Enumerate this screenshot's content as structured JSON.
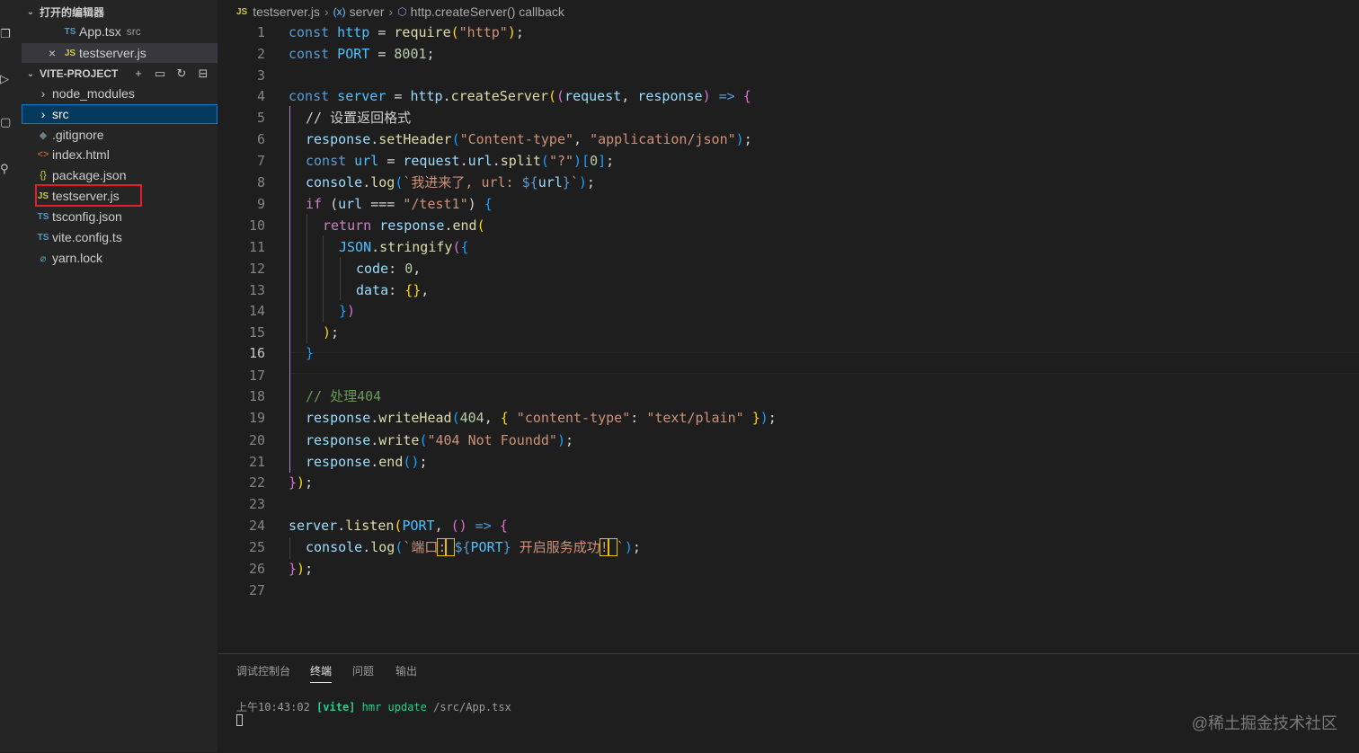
{
  "open_editors": {
    "header": "打开的编辑器",
    "items": [
      {
        "badge": "TS",
        "name": "App.tsx",
        "suffix": "src"
      },
      {
        "badge": "JS",
        "name": "testserver.js",
        "close": "×"
      }
    ]
  },
  "explorer": {
    "header": "VITE-PROJECT",
    "items": [
      {
        "icon": "›",
        "name": "node_modules"
      },
      {
        "icon": "›",
        "name": "src"
      },
      {
        "icon": "◆",
        "name": ".gitignore"
      },
      {
        "icon": "<>",
        "name": "index.html"
      },
      {
        "icon": "{}",
        "name": "package.json"
      },
      {
        "icon": "JS",
        "name": "testserver.js"
      },
      {
        "icon": "TS",
        "name": "tsconfig.json"
      },
      {
        "icon": "TS",
        "name": "vite.config.ts"
      },
      {
        "icon": "⌀",
        "name": "yarn.lock"
      }
    ]
  },
  "breadcrumb": {
    "file_badge": "JS",
    "file": "testserver.js",
    "sep": "›",
    "symbol1": "server",
    "symbol2": "http.createServer() callback"
  },
  "editor": {
    "current_line": 16,
    "lines": [
      "1",
      "2",
      "3",
      "4",
      "5",
      "6",
      "7",
      "8",
      "9",
      "10",
      "11",
      "12",
      "13",
      "14",
      "15",
      "16",
      "17",
      "18",
      "19",
      "20",
      "21",
      "22",
      "23",
      "24",
      "25",
      "26",
      "27"
    ]
  },
  "code": {
    "l1": {
      "a": "const",
      "b": " http ",
      "c": "=",
      "d": " require",
      "e": "(",
      "f": "\"http\"",
      "g": ")",
      "h": ";"
    },
    "l2": {
      "a": "const",
      "b": " PORT ",
      "c": "=",
      "d": " 8001",
      "e": ";"
    },
    "l4": {
      "a": "const",
      "b": " server ",
      "c": "=",
      "d": " http",
      "e": ".",
      "f": "createServer",
      "g": "(",
      "h": "(",
      "i": "request",
      "j": ", ",
      "k": "response",
      "l": ")",
      "m": " => ",
      "n": "{"
    },
    "l5": "// 设置返回格式",
    "l6": {
      "a": "response",
      "b": ".",
      "c": "setHeader",
      "d": "(",
      "e": "\"Content-type\"",
      "f": ", ",
      "g": "\"application/json\"",
      "h": ")",
      "i": ";"
    },
    "l7": {
      "a": "const",
      "b": " url ",
      "c": "=",
      "d": " request",
      "e": ".",
      "f": "url",
      "g": ".",
      "h": "split",
      "i": "(",
      "j": "\"?\"",
      "k": ")",
      "l": "[",
      "m": "0",
      "n": "]",
      "o": ";"
    },
    "l8": {
      "a": "console",
      "b": ".",
      "c": "log",
      "d": "(",
      "e": "`我进来了, url: ",
      "f": "${",
      "g": "url",
      "h": "}",
      "i": "`",
      "j": ")",
      "k": ";"
    },
    "l9": {
      "a": "if",
      "b": " (",
      "c": "url",
      "d": " === ",
      "e": "\"/test1\"",
      "f": ") ",
      "g": "{"
    },
    "l10": {
      "a": "return",
      "b": " response",
      "c": ".",
      "d": "end",
      "e": "("
    },
    "l11": {
      "a": "JSON",
      "b": ".",
      "c": "stringify",
      "d": "(",
      "e": "{"
    },
    "l12": {
      "a": "code",
      "b": ": ",
      "c": "0",
      "d": ","
    },
    "l13": {
      "a": "data",
      "b": ": ",
      "c": "{}",
      "d": ","
    },
    "l14": {
      "a": "}",
      "b": ")"
    },
    "l15": {
      "a": ")",
      "b": ";"
    },
    "l16": "}",
    "l18": "// 处理404",
    "l19": {
      "a": "response",
      "b": ".",
      "c": "writeHead",
      "d": "(",
      "e": "404",
      "f": ", ",
      "g": "{",
      "h": " \"content-type\"",
      "i": ": ",
      "j": "\"text/plain\"",
      "k": " }",
      "l": ")",
      "m": ";"
    },
    "l20": {
      "a": "response",
      "b": ".",
      "c": "write",
      "d": "(",
      "e": "\"404 Not Foundd\"",
      "f": ")",
      "g": ";"
    },
    "l21": {
      "a": "response",
      "b": ".",
      "c": "end",
      "d": "()",
      "e": ";"
    },
    "l22": {
      "a": "}",
      "b": ")",
      "c": ";"
    },
    "l24": {
      "a": "server",
      "b": ".",
      "c": "listen",
      "d": "(",
      "e": "PORT",
      "f": ", ",
      "g": "()",
      "h": " => ",
      "i": "{"
    },
    "l25": {
      "a": "console",
      "b": ".",
      "c": "log",
      "d": "(",
      "e": "`端口",
      "f": ":",
      "g": " ",
      "h": "${",
      "i": "PORT",
      "j": "}",
      "k": " 开启服务成功",
      "l": "!",
      "m": " ",
      "n": "`",
      "o": ")",
      "p": ";"
    },
    "l26": {
      "a": "}",
      "b": ")",
      "c": ";"
    }
  },
  "panel": {
    "tabs": [
      "调试控制台",
      "终端",
      "问题",
      "输出"
    ],
    "terminal": {
      "time": "上午10:43:02",
      "tag": "[vite]",
      "msg": "hmr update",
      "path": "/src/App.tsx"
    }
  },
  "watermark": "@稀土掘金技术社区",
  "colors": {
    "accent": "#007fd4",
    "selection": "#04395e",
    "highlight_box": "#e0202a"
  }
}
